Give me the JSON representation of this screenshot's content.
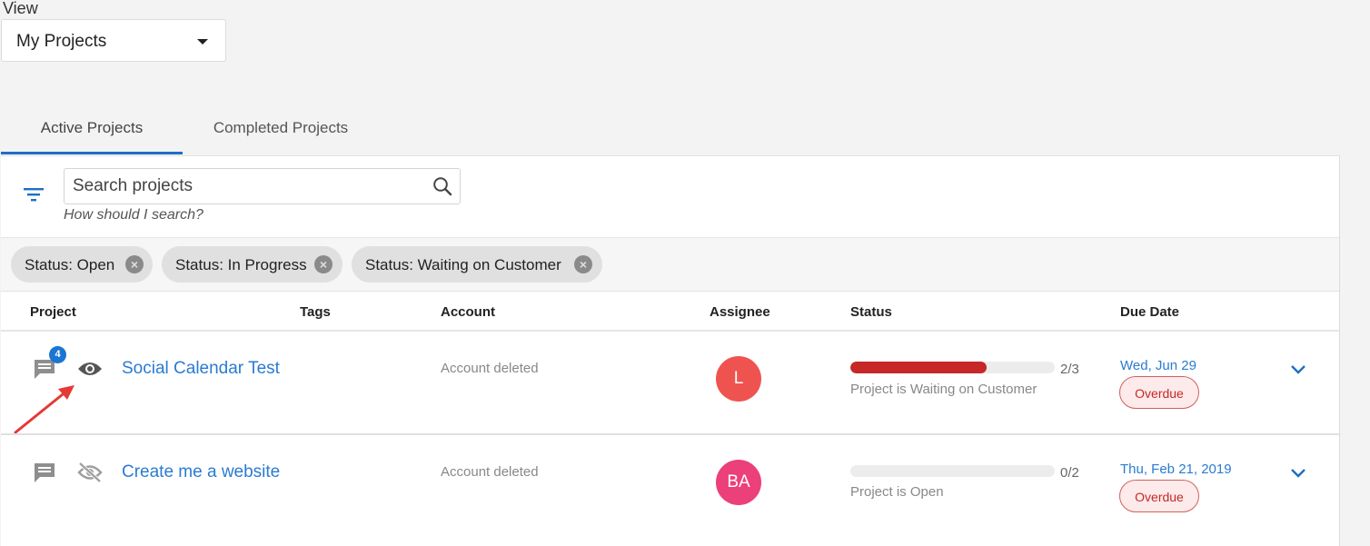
{
  "view": {
    "label": "View",
    "selected": "My Projects"
  },
  "tabs": [
    {
      "label": "Active Projects",
      "active": true
    },
    {
      "label": "Completed Projects",
      "active": false
    }
  ],
  "search": {
    "placeholder": "Search projects",
    "hint": "How should I search?"
  },
  "filters": [
    {
      "label": "Status: Open"
    },
    {
      "label": "Status: In Progress"
    },
    {
      "label": "Status: Waiting on Customer"
    }
  ],
  "columns": {
    "project": "Project",
    "tags": "Tags",
    "account": "Account",
    "assignee": "Assignee",
    "status": "Status",
    "due_date": "Due Date"
  },
  "rows": [
    {
      "comment_count": "4",
      "visibility_icon": "eye-icon",
      "name": "Social Calendar Test",
      "account": "Account deleted",
      "assignee_initials": "L",
      "assignee_color": "#ef5350",
      "progress": "2/3",
      "progress_fraction": 0.667,
      "status": "Project is Waiting on Customer",
      "due": "Wed, Jun 29",
      "due_badge": "Overdue"
    },
    {
      "comment_count": "",
      "visibility_icon": "eye-off-icon",
      "name": "Create me a website",
      "account": "Account deleted",
      "assignee_initials": "BA",
      "assignee_color": "#ec407a",
      "progress": "0/2",
      "progress_fraction": 0,
      "status": "Project is Open",
      "due": "Thu, Feb 21, 2019",
      "due_badge": "Overdue"
    }
  ],
  "colors": {
    "accent": "#1e6fc3",
    "overdue": "#c62828",
    "annotation_arrow": "#e53935"
  }
}
